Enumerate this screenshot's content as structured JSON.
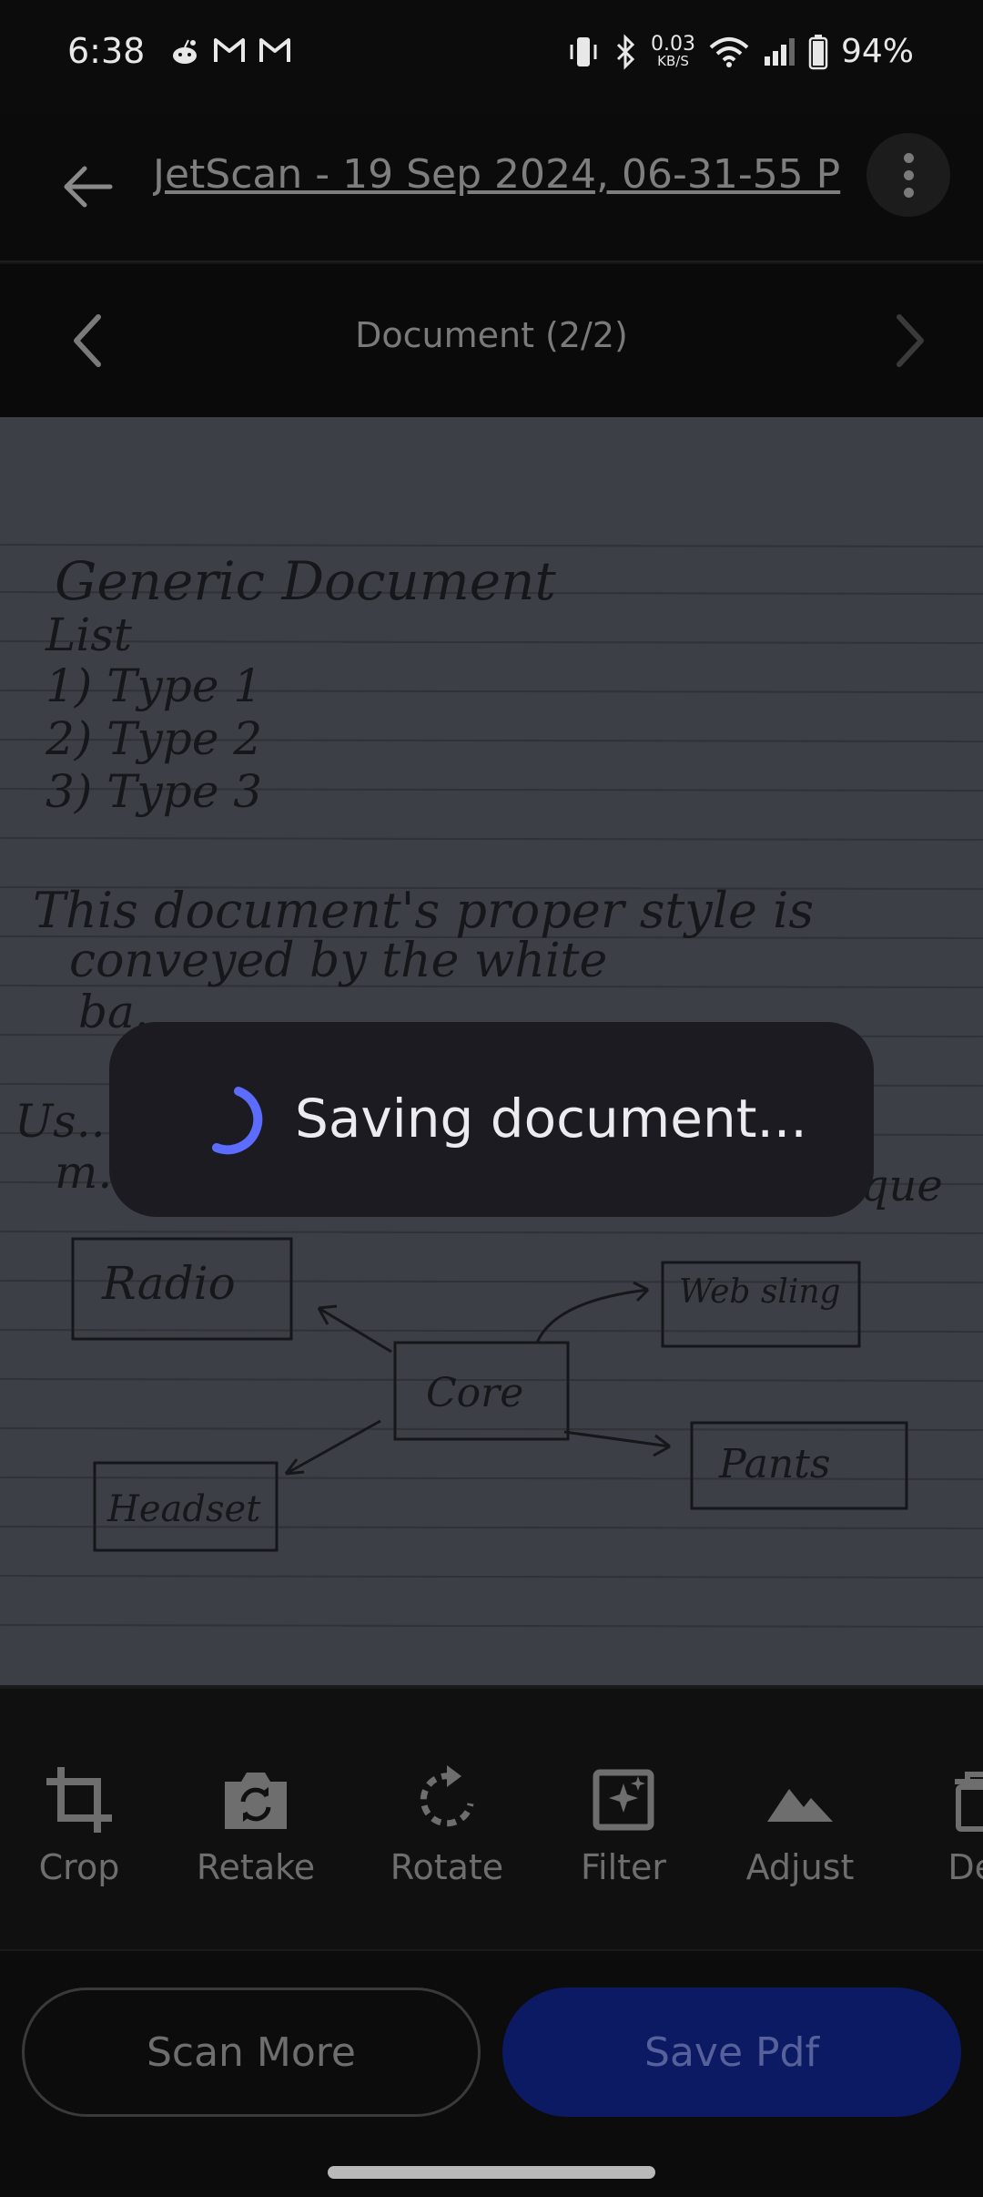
{
  "status_bar": {
    "time": "6:38",
    "left_icons": [
      "reddit-icon",
      "gmail-icon",
      "gmail-icon"
    ],
    "net_speed_value": "0.03",
    "net_speed_unit": "KB/S",
    "battery": "94%"
  },
  "app_bar": {
    "title": "JetScan - 19 Sep 2024, 06-31-55 P"
  },
  "pager": {
    "label": "Document (2/2)"
  },
  "document": {
    "lines": [
      "Generic Document",
      "List",
      "1) Type 1",
      "2) Type 2",
      "3) Type 3",
      "This document's proper style is",
      "conveyed by the white",
      "ba...",
      "Us...",
      "m...",
      "...que"
    ],
    "diagram": {
      "center": "Core",
      "nodes": [
        "Radio",
        "Web sling",
        "Pants",
        "Headset"
      ]
    }
  },
  "toolbar": {
    "tools": [
      {
        "label": "Crop",
        "icon": "crop-icon"
      },
      {
        "label": "Retake",
        "icon": "camera-retake-icon"
      },
      {
        "label": "Rotate",
        "icon": "rotate-icon"
      },
      {
        "label": "Filter",
        "icon": "filter-icon"
      },
      {
        "label": "Adjust",
        "icon": "adjust-icon"
      },
      {
        "label": "Del",
        "icon": "delete-icon"
      }
    ]
  },
  "actions": {
    "scan_more": "Scan More",
    "save_pdf": "Save Pdf"
  },
  "dialog": {
    "message": "Saving document..."
  },
  "colors": {
    "spinner": "#5b6cff",
    "save_button": "#0c1a63",
    "dialog_bg": "#1c1b22"
  }
}
